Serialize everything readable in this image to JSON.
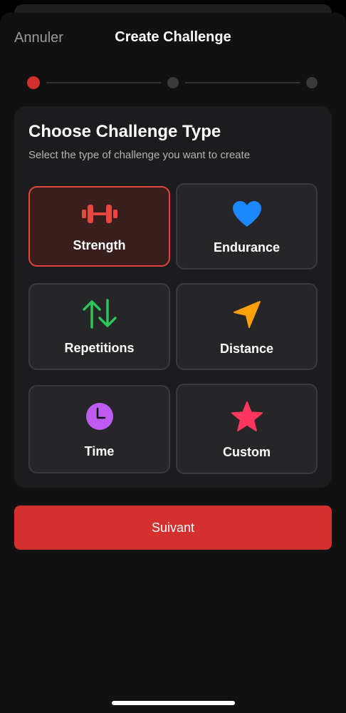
{
  "nav": {
    "cancel_label": "Annuler",
    "title": "Create Challenge"
  },
  "progress": {
    "current_step": 1,
    "total_steps": 3
  },
  "card": {
    "title": "Choose Challenge Type",
    "subtitle": "Select the type of challenge you want to create"
  },
  "types": [
    {
      "label": "Strength",
      "icon": "dumbbell-icon",
      "color": "#e8473f",
      "selected": true
    },
    {
      "label": "Endurance",
      "icon": "heart-icon",
      "color": "#1e88ff",
      "selected": false
    },
    {
      "label": "Repetitions",
      "icon": "arrows-up-down-icon",
      "color": "#2ec45a",
      "selected": false
    },
    {
      "label": "Distance",
      "icon": "location-arrow-icon",
      "color": "#ff9f0a",
      "selected": false
    },
    {
      "label": "Time",
      "icon": "clock-icon",
      "color": "#bf5af2",
      "selected": false
    },
    {
      "label": "Custom",
      "icon": "star-icon",
      "color": "#ff375f",
      "selected": false
    }
  ],
  "next_button": {
    "label": "Suivant"
  },
  "colors": {
    "accent": "#d3302f",
    "background": "#111111",
    "card": "#1c1c1e"
  }
}
